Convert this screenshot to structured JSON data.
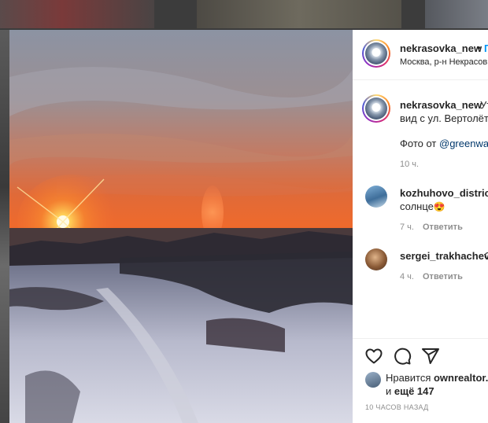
{
  "post": {
    "username": "nekrasovka_new",
    "follow_label": "П",
    "location": "Москва, р-н Некрасовка",
    "caption_line1": "Ут",
    "caption_line2": "вид с ул. Вертолётч",
    "photo_credit_prefix": "Фото от ",
    "photo_credit_handle": "@greenway",
    "caption_time": "10 ч."
  },
  "comments": [
    {
      "username": "kozhuhovo_district",
      "text": "солнце",
      "emoji": "😍",
      "time": "7 ч.",
      "reply_label": "Ответить"
    },
    {
      "username": "sergei_trakhachev",
      "text": "С",
      "time": "4 ч.",
      "reply_label": "Ответить"
    }
  ],
  "likes": {
    "prefix": "Нравится ",
    "user": "ownrealtor.re",
    "and": "и ",
    "more": "ещё 147"
  },
  "timestamp": "10 ЧАСОВ НАЗАД",
  "icons": [
    "heart-icon",
    "comment-icon",
    "share-icon"
  ]
}
